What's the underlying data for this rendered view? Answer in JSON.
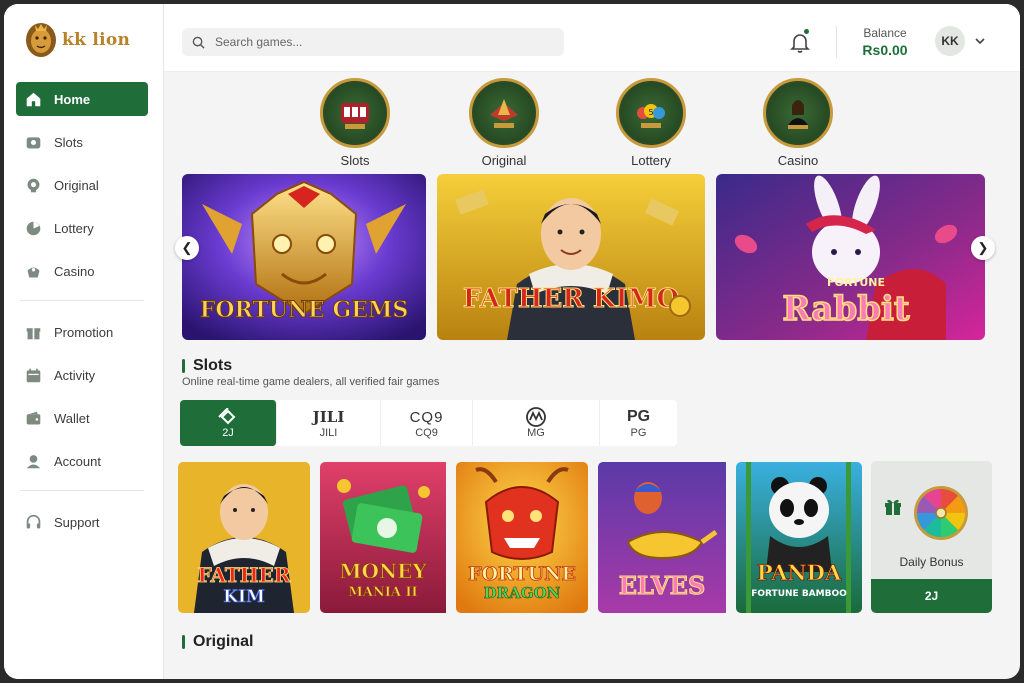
{
  "brand": {
    "name": "kk lion"
  },
  "search": {
    "placeholder": "Search games..."
  },
  "header": {
    "balance_label": "Balance",
    "balance_value": "Rs0.00",
    "avatar_initials": "KK"
  },
  "sidebar": {
    "items": [
      {
        "label": "Home",
        "icon": "home-icon",
        "active": true
      },
      {
        "label": "Slots",
        "icon": "slots-icon"
      },
      {
        "label": "Original",
        "icon": "original-icon"
      },
      {
        "label": "Lottery",
        "icon": "lottery-icon"
      },
      {
        "label": "Casino",
        "icon": "casino-icon"
      },
      {
        "label": "Promotion",
        "icon": "gift-icon"
      },
      {
        "label": "Activity",
        "icon": "calendar-icon"
      },
      {
        "label": "Wallet",
        "icon": "wallet-icon"
      },
      {
        "label": "Account",
        "icon": "user-icon"
      },
      {
        "label": "Support",
        "icon": "headset-icon"
      }
    ]
  },
  "categories": [
    {
      "label": "Slots",
      "badge": "SLOTS"
    },
    {
      "label": "Original",
      "badge": "ORIGINAL"
    },
    {
      "label": "Lottery",
      "badge": "LOTTERY"
    },
    {
      "label": "Casino",
      "badge": "CASINO"
    }
  ],
  "banners": [
    {
      "title": "FORTUNE GEMS"
    },
    {
      "title": "FATHER KIMO"
    },
    {
      "title_small": "FORTUNE",
      "title": "Rabbit"
    }
  ],
  "slots_section": {
    "title": "Slots",
    "subtitle": "Online real-time game dealers, all verified fair games",
    "providers": [
      {
        "logo": "",
        "label": "2J",
        "active": true
      },
      {
        "logo": "JILI",
        "label": "JILI"
      },
      {
        "logo": "CQ9",
        "label": "CQ9"
      },
      {
        "logo": "",
        "label": "MG"
      },
      {
        "logo": "PG",
        "label": "PG"
      }
    ],
    "games": [
      {
        "line1": "FATHER",
        "line2": "KIM"
      },
      {
        "line1": "MONEY",
        "line2": "MANIA II"
      },
      {
        "line1": "FORTUNE",
        "line2": "DRAGON"
      },
      {
        "line1": "ELVES",
        "line2": ""
      },
      {
        "line1": "PANDA",
        "line2": "FORTUNE BAMBOO"
      }
    ],
    "daily_bonus": {
      "label": "Daily Bonus",
      "button": "2J"
    }
  },
  "original_section": {
    "title": "Original"
  },
  "colors": {
    "accent": "#1f6e3a",
    "gold": "#c79a3c"
  }
}
